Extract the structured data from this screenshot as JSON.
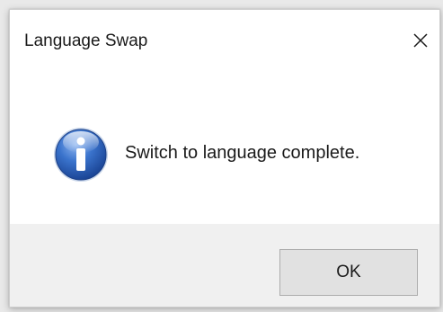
{
  "dialog": {
    "title": "Language Swap",
    "close_icon": "close-icon",
    "info_icon": "info-icon",
    "message": "Switch to language complete.",
    "ok_label": "OK"
  },
  "colors": {
    "info_icon_blue": "#2a5fb8",
    "footer_bg": "#f0f0f0",
    "button_bg": "#e1e1e1"
  }
}
